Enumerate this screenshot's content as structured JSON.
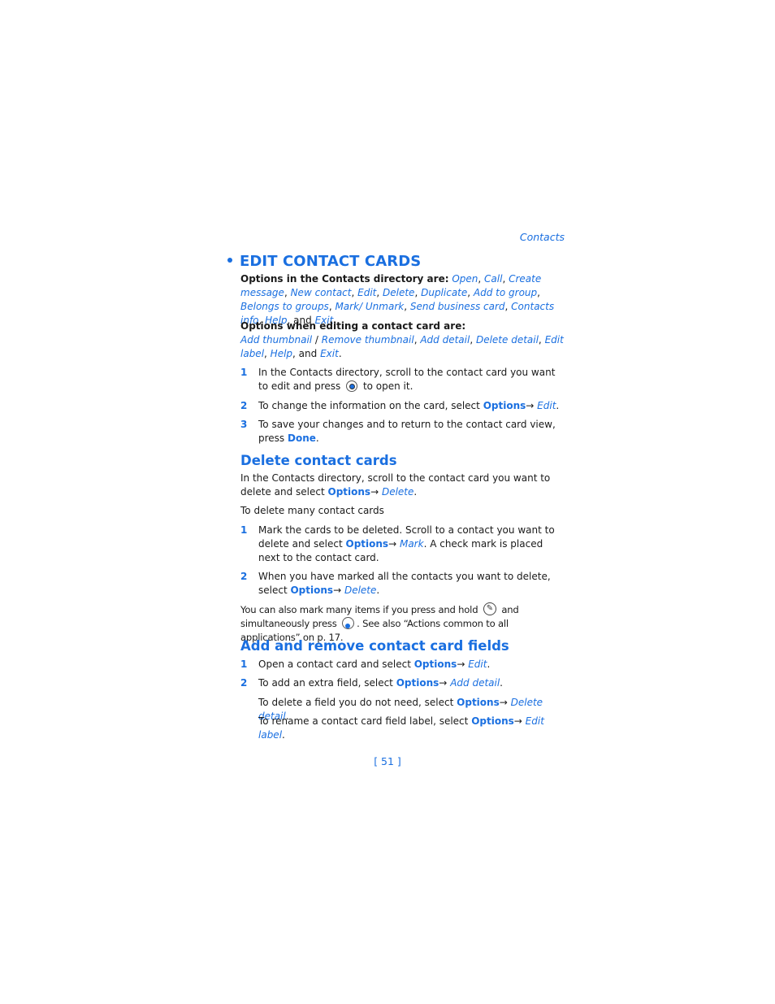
{
  "running_head": "Contacts",
  "title": "EDIT CONTACT CARDS",
  "intro": {
    "directory_label": "Options in the Contacts directory are:",
    "directory_options": [
      "Open",
      "Call",
      "Create message",
      "New contact",
      "Edit",
      "Delete",
      "Duplicate",
      "Add to group",
      "Belongs to groups",
      "Mark/ Unmark",
      "Send business card",
      "Contacts info",
      "Help",
      "Exit"
    ],
    "editing_label": "Options when editing a contact card are:",
    "editing_options": [
      "Add thumbnail",
      "Remove thumbnail",
      "Add detail",
      "Delete detail",
      "Edit label",
      "Help",
      "Exit"
    ],
    "and": "and"
  },
  "edit_steps": [
    {
      "num": "1",
      "text_a": "In the Contacts directory, scroll to the contact card you want to edit and press",
      "icon": "navi-key-icon",
      "text_b": "to open it."
    },
    {
      "num": "2",
      "text_a": "To change the information on the card, select",
      "bold": "Options",
      "arrow": "→",
      "italic": "Edit",
      "text_b": "."
    },
    {
      "num": "3",
      "text_a": "To save your changes and to return to the contact card view, press",
      "bold": "Done",
      "text_b": "."
    }
  ],
  "delete": {
    "heading": "Delete contact cards",
    "para_a": "In the Contacts directory, scroll to the contact card you want to delete and select",
    "para_bold": "Options",
    "para_arrow": "→",
    "para_italic": "Delete",
    "para_end": ".",
    "many_label": "To delete many contact cards",
    "steps": [
      {
        "num": "1",
        "text_a": "Mark the cards to be deleted. Scroll to a contact you want to delete and select",
        "bold": "Options",
        "arrow": "→",
        "italic": "Mark",
        "text_b": ". A check mark is placed next to the contact card."
      },
      {
        "num": "2",
        "text_a": "When you have marked all the contacts you want to delete, select",
        "bold": "Options",
        "arrow": "→",
        "italic": "Delete",
        "text_b": "."
      }
    ],
    "note_a": "You can also mark many items if you press and hold",
    "note_icon1": "edit-key-icon",
    "note_b": "and simultaneously press",
    "note_icon2": "scroll-key-icon",
    "note_c": ". See also “Actions common to all applications” on p. 17."
  },
  "fields": {
    "heading": "Add and remove contact card fields",
    "steps": [
      {
        "num": "1",
        "text_a": "Open a contact card and select",
        "bold": "Options",
        "arrow": "→",
        "italic": "Edit",
        "text_b": "."
      },
      {
        "num": "2",
        "text_a": "To add an extra field, select",
        "bold": "Options",
        "arrow": "→",
        "italic": "Add detail",
        "text_b": "."
      }
    ],
    "extra": [
      {
        "text_a": "To delete a field you do not need, select",
        "bold": "Options",
        "arrow": "→",
        "italic": "Delete detail",
        "text_b": "."
      },
      {
        "text_a": "To rename a contact card field label, select",
        "bold": "Options",
        "arrow": "→",
        "italic": "Edit label",
        "text_b": "."
      }
    ]
  },
  "page_number": "[ 51 ]"
}
